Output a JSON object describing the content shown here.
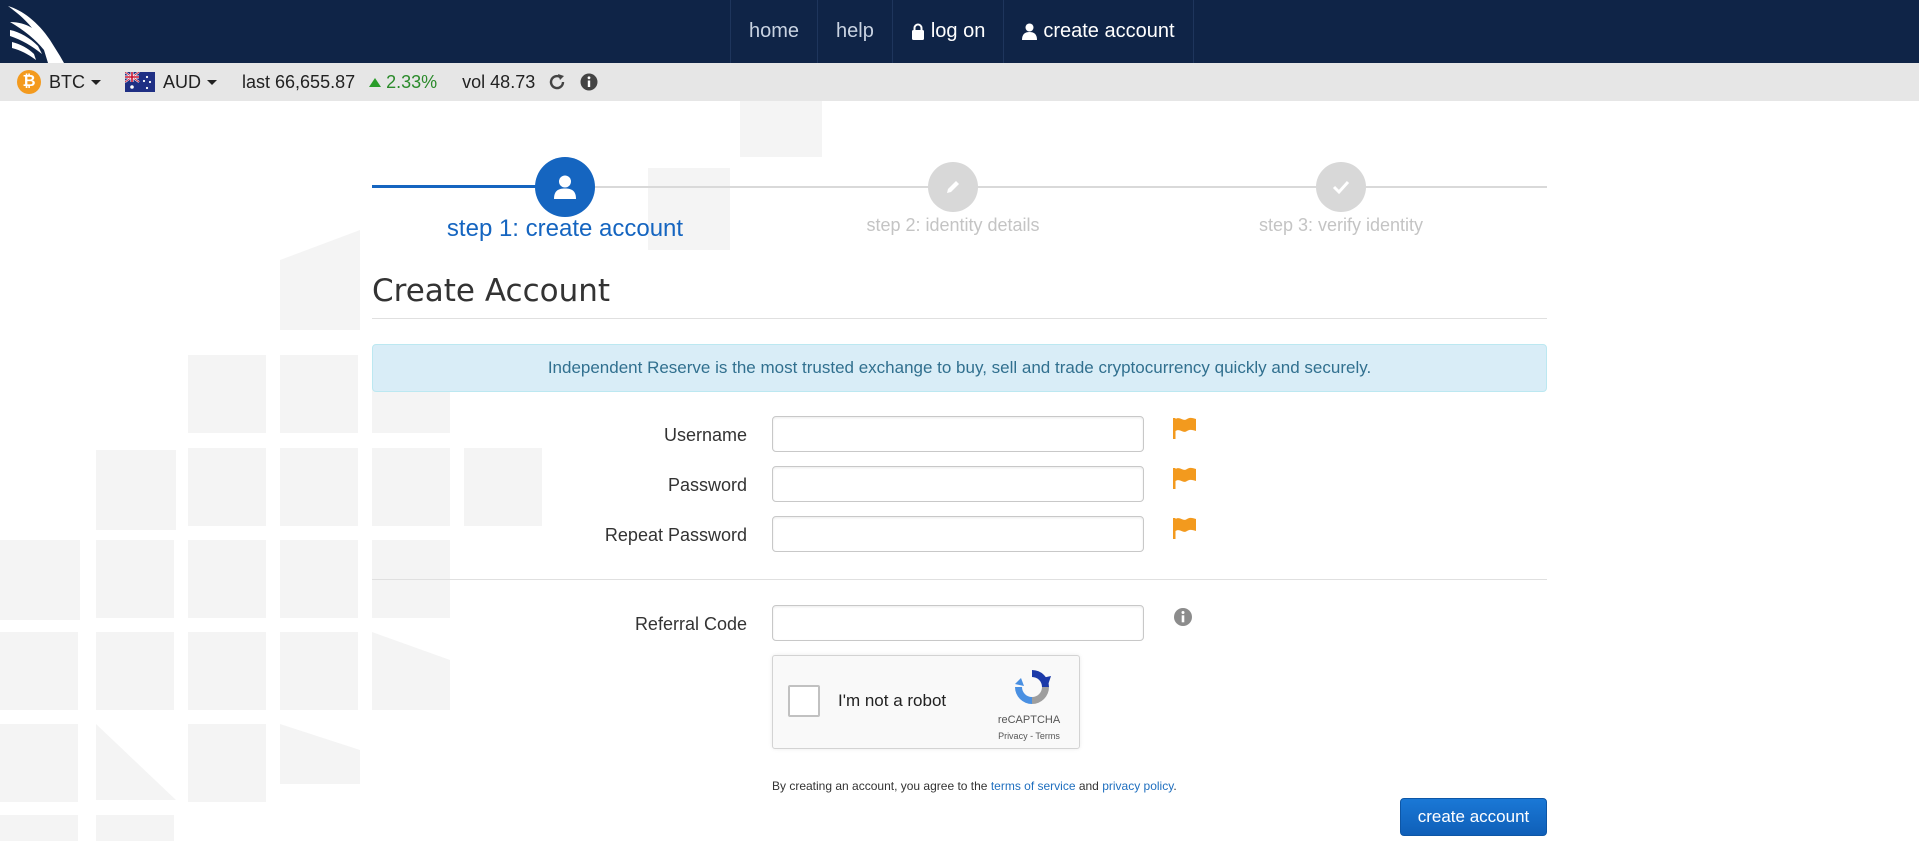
{
  "nav": {
    "home": "home",
    "help": "help",
    "logon": "log on",
    "create_account": "create account"
  },
  "ticker": {
    "coin": "BTC",
    "coin_symbol": "₿",
    "currency": "AUD",
    "last": "last 66,655.87",
    "change": "2.33%",
    "vol": "vol 48.73",
    "refresh_icon": "refresh-icon",
    "info_icon": "info-icon"
  },
  "stepper": {
    "step1": "step 1: create account",
    "step2": "step 2: identity details",
    "step3": "step 3: verify identity"
  },
  "page": {
    "title": "Create Account",
    "banner": "Independent Reserve is the most trusted exchange to buy, sell and trade cryptocurrency quickly and securely."
  },
  "form": {
    "username_label": "Username",
    "username_value": "",
    "password_label": "Password",
    "password_value": "",
    "repeat_label": "Repeat Password",
    "repeat_value": "",
    "referral_label": "Referral Code",
    "referral_value": ""
  },
  "recaptcha": {
    "text": "I'm not a robot",
    "brand": "reCAPTCHA",
    "privacy": "Privacy",
    "sep": " - ",
    "terms": "Terms"
  },
  "agreement": {
    "prefix": "By creating an account, you agree to the ",
    "tos": "terms of service",
    "and": " and ",
    "privacy": "privacy policy",
    "suffix": "."
  },
  "submit_label": "create account",
  "colors": {
    "nav_bg": "#0f2447",
    "accent": "#1565c0",
    "flag": "#f39a1e",
    "banner_bg": "#d9edf7"
  }
}
